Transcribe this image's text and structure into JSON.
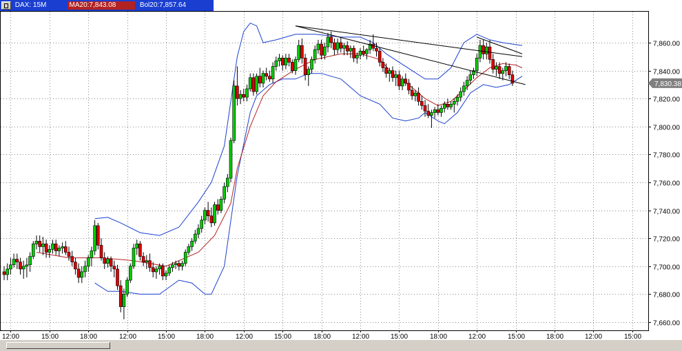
{
  "header": {
    "symbol_label": "DAX: 15M",
    "ma_label": "MA20:7,843.08",
    "bol_label": "Bol20:7,857.64"
  },
  "price_tag": "7,830.38",
  "colors": {
    "up_candle": "#00cc00",
    "down_candle": "#dd0000",
    "ma_line": "#b22222",
    "bollinger": "#1a3fd0",
    "header_bg": "#1a3fd0"
  },
  "chart_data": {
    "type": "candlestick",
    "ylim": [
      7655,
      7880
    ],
    "y_ticks": [
      7660,
      7680,
      7700,
      7720,
      7740,
      7760,
      7780,
      7800,
      7820,
      7840,
      7860
    ],
    "y_tick_labels": [
      "7,660.00",
      "7,680.00",
      "7,700.00",
      "7,720.00",
      "7,740.00",
      "7,760.00",
      "7,780.00",
      "7,800.00",
      "7,820.00",
      "7,840.00",
      "7,860.00"
    ],
    "x_ticks": [
      {
        "label": "12:00",
        "i": 2
      },
      {
        "label": "15:00",
        "i": 14
      },
      {
        "label": "18:00",
        "i": 26
      },
      {
        "label": "12:00",
        "i": 38
      },
      {
        "label": "15:00",
        "i": 50
      },
      {
        "label": "18:00",
        "i": 62
      },
      {
        "label": "12:00",
        "i": 74
      },
      {
        "label": "15:00",
        "i": 86
      },
      {
        "label": "18:00",
        "i": 98
      },
      {
        "label": "12:00",
        "i": 110
      },
      {
        "label": "15:00",
        "i": 122
      },
      {
        "label": "18:00",
        "i": 134
      },
      {
        "label": "12:00",
        "i": 146
      },
      {
        "label": "15:00",
        "i": 158
      },
      {
        "label": "18:00",
        "i": 170
      },
      {
        "label": "12:00",
        "i": 182
      },
      {
        "label": "15:00",
        "i": 194
      }
    ],
    "candles": [
      [
        7696,
        7700,
        7690,
        7694
      ],
      [
        7694,
        7702,
        7690,
        7698
      ],
      [
        7698,
        7706,
        7694,
        7701
      ],
      [
        7701,
        7709,
        7699,
        7705
      ],
      [
        7705,
        7709,
        7698,
        7703
      ],
      [
        7703,
        7706,
        7694,
        7698
      ],
      [
        7698,
        7704,
        7691,
        7700
      ],
      [
        7700,
        7706,
        7692,
        7701
      ],
      [
        7701,
        7710,
        7696,
        7707
      ],
      [
        7707,
        7718,
        7705,
        7716
      ],
      [
        7716,
        7722,
        7712,
        7718
      ],
      [
        7718,
        7722,
        7710,
        7714
      ],
      [
        7714,
        7721,
        7708,
        7716
      ],
      [
        7716,
        7719,
        7706,
        7710
      ],
      [
        7710,
        7715,
        7706,
        7712
      ],
      [
        7712,
        7719,
        7709,
        7716
      ],
      [
        7716,
        7719,
        7708,
        7711
      ],
      [
        7711,
        7715,
        7707,
        7713
      ],
      [
        7713,
        7717,
        7709,
        7714
      ],
      [
        7714,
        7718,
        7708,
        7710
      ],
      [
        7710,
        7714,
        7704,
        7707
      ],
      [
        7707,
        7711,
        7700,
        7703
      ],
      [
        7703,
        7706,
        7694,
        7698
      ],
      [
        7698,
        7702,
        7688,
        7692
      ],
      [
        7692,
        7700,
        7688,
        7696
      ],
      [
        7696,
        7704,
        7692,
        7700
      ],
      [
        7700,
        7708,
        7696,
        7706
      ],
      [
        7706,
        7714,
        7700,
        7711
      ],
      [
        7711,
        7733,
        7708,
        7729
      ],
      [
        7729,
        7731,
        7712,
        7715
      ],
      [
        7715,
        7720,
        7704,
        7706
      ],
      [
        7706,
        7710,
        7698,
        7702
      ],
      [
        7702,
        7707,
        7699,
        7705
      ],
      [
        7705,
        7707,
        7696,
        7700
      ],
      [
        7700,
        7704,
        7692,
        7698
      ],
      [
        7698,
        7701,
        7683,
        7686
      ],
      [
        7686,
        7690,
        7667,
        7671
      ],
      [
        7671,
        7684,
        7662,
        7680
      ],
      [
        7680,
        7692,
        7678,
        7690
      ],
      [
        7690,
        7702,
        7688,
        7700
      ],
      [
        7700,
        7716,
        7698,
        7713
      ],
      [
        7713,
        7719,
        7708,
        7716
      ],
      [
        7716,
        7718,
        7704,
        7707
      ],
      [
        7707,
        7710,
        7700,
        7703
      ],
      [
        7703,
        7708,
        7698,
        7704
      ],
      [
        7704,
        7709,
        7696,
        7699
      ],
      [
        7699,
        7703,
        7692,
        7696
      ],
      [
        7696,
        7700,
        7691,
        7698
      ],
      [
        7698,
        7702,
        7694,
        7700
      ],
      [
        7700,
        7702,
        7690,
        7693
      ],
      [
        7693,
        7697,
        7690,
        7695
      ],
      [
        7695,
        7701,
        7693,
        7699
      ],
      [
        7699,
        7703,
        7696,
        7701
      ],
      [
        7701,
        7704,
        7698,
        7702
      ],
      [
        7702,
        7704,
        7697,
        7700
      ],
      [
        7700,
        7704,
        7697,
        7702
      ],
      [
        7702,
        7712,
        7700,
        7710
      ],
      [
        7710,
        7716,
        7708,
        7714
      ],
      [
        7714,
        7720,
        7711,
        7718
      ],
      [
        7718,
        7726,
        7716,
        7723
      ],
      [
        7723,
        7730,
        7720,
        7727
      ],
      [
        7727,
        7736,
        7724,
        7733
      ],
      [
        7733,
        7742,
        7730,
        7740
      ],
      [
        7740,
        7746,
        7732,
        7736
      ],
      [
        7736,
        7742,
        7728,
        7731
      ],
      [
        7731,
        7746,
        7729,
        7744
      ],
      [
        7744,
        7748,
        7737,
        7740
      ],
      [
        7740,
        7750,
        7738,
        7748
      ],
      [
        7748,
        7760,
        7745,
        7757
      ],
      [
        7757,
        7766,
        7753,
        7763
      ],
      [
        7763,
        7792,
        7760,
        7790
      ],
      [
        7790,
        7833,
        7788,
        7829
      ],
      [
        7829,
        7843,
        7815,
        7820
      ],
      [
        7820,
        7826,
        7816,
        7823
      ],
      [
        7823,
        7827,
        7818,
        7821
      ],
      [
        7821,
        7830,
        7818,
        7827
      ],
      [
        7827,
        7838,
        7825,
        7835
      ],
      [
        7835,
        7838,
        7822,
        7825
      ],
      [
        7825,
        7838,
        7823,
        7836
      ],
      [
        7836,
        7842,
        7828,
        7831
      ],
      [
        7831,
        7840,
        7828,
        7838
      ],
      [
        7838,
        7842,
        7833,
        7836
      ],
      [
        7836,
        7840,
        7832,
        7834
      ],
      [
        7834,
        7846,
        7831,
        7843
      ],
      [
        7843,
        7850,
        7840,
        7847
      ],
      [
        7847,
        7852,
        7843,
        7849
      ],
      [
        7849,
        7851,
        7840,
        7844
      ],
      [
        7844,
        7852,
        7841,
        7849
      ],
      [
        7849,
        7852,
        7843,
        7846
      ],
      [
        7846,
        7848,
        7838,
        7840
      ],
      [
        7840,
        7850,
        7837,
        7848
      ],
      [
        7848,
        7862,
        7846,
        7858
      ],
      [
        7858,
        7863,
        7845,
        7849
      ],
      [
        7849,
        7852,
        7833,
        7837
      ],
      [
        7837,
        7843,
        7829,
        7841
      ],
      [
        7841,
        7850,
        7838,
        7848
      ],
      [
        7848,
        7858,
        7845,
        7855
      ],
      [
        7855,
        7862,
        7852,
        7859
      ],
      [
        7859,
        7862,
        7848,
        7851
      ],
      [
        7851,
        7860,
        7848,
        7857
      ],
      [
        7857,
        7867,
        7853,
        7864
      ],
      [
        7864,
        7868,
        7856,
        7860
      ],
      [
        7860,
        7863,
        7851,
        7855
      ],
      [
        7855,
        7863,
        7852,
        7860
      ],
      [
        7860,
        7864,
        7853,
        7856
      ],
      [
        7856,
        7860,
        7851,
        7858
      ],
      [
        7858,
        7861,
        7851,
        7854
      ],
      [
        7854,
        7858,
        7849,
        7856
      ],
      [
        7856,
        7858,
        7846,
        7849
      ],
      [
        7849,
        7853,
        7845,
        7851
      ],
      [
        7851,
        7856,
        7848,
        7854
      ],
      [
        7854,
        7858,
        7850,
        7852
      ],
      [
        7852,
        7856,
        7848,
        7855
      ],
      [
        7855,
        7862,
        7852,
        7859
      ],
      [
        7859,
        7866,
        7854,
        7856
      ],
      [
        7856,
        7860,
        7850,
        7854
      ],
      [
        7854,
        7856,
        7843,
        7846
      ],
      [
        7846,
        7849,
        7839,
        7842
      ],
      [
        7842,
        7845,
        7835,
        7838
      ],
      [
        7838,
        7842,
        7832,
        7840
      ],
      [
        7840,
        7843,
        7832,
        7835
      ],
      [
        7835,
        7840,
        7829,
        7837
      ],
      [
        7837,
        7840,
        7826,
        7829
      ],
      [
        7829,
        7836,
        7826,
        7834
      ],
      [
        7834,
        7838,
        7829,
        7831
      ],
      [
        7831,
        7834,
        7823,
        7826
      ],
      [
        7826,
        7829,
        7819,
        7822
      ],
      [
        7822,
        7826,
        7818,
        7824
      ],
      [
        7824,
        7828,
        7815,
        7818
      ],
      [
        7818,
        7822,
        7812,
        7815
      ],
      [
        7815,
        7819,
        7807,
        7811
      ],
      [
        7811,
        7816,
        7806,
        7808
      ],
      [
        7808,
        7812,
        7799,
        7810
      ],
      [
        7810,
        7814,
        7806,
        7812
      ],
      [
        7812,
        7816,
        7808,
        7810
      ],
      [
        7810,
        7815,
        7807,
        7813
      ],
      [
        7813,
        7818,
        7810,
        7816
      ],
      [
        7816,
        7820,
        7812,
        7814
      ],
      [
        7814,
        7818,
        7812,
        7816
      ],
      [
        7816,
        7820,
        7810,
        7818
      ],
      [
        7818,
        7823,
        7815,
        7821
      ],
      [
        7821,
        7828,
        7818,
        7825
      ],
      [
        7825,
        7832,
        7822,
        7829
      ],
      [
        7829,
        7836,
        7826,
        7833
      ],
      [
        7833,
        7840,
        7830,
        7837
      ],
      [
        7837,
        7842,
        7834,
        7840
      ],
      [
        7840,
        7852,
        7836,
        7849
      ],
      [
        7849,
        7862,
        7846,
        7858
      ],
      [
        7858,
        7862,
        7848,
        7852
      ],
      [
        7852,
        7860,
        7848,
        7857
      ],
      [
        7857,
        7862,
        7845,
        7848
      ],
      [
        7848,
        7852,
        7838,
        7841
      ],
      [
        7841,
        7846,
        7836,
        7843
      ],
      [
        7843,
        7846,
        7834,
        7838
      ],
      [
        7838,
        7842,
        7833,
        7840
      ],
      [
        7840,
        7846,
        7836,
        7843
      ],
      [
        7843,
        7845,
        7834,
        7837
      ],
      [
        7837,
        7840,
        7829,
        7831
      ]
    ],
    "ma20": [
      [
        10,
        7710
      ],
      [
        20,
        7706
      ],
      [
        30,
        7706
      ],
      [
        40,
        7704
      ],
      [
        50,
        7700
      ],
      [
        60,
        7710
      ],
      [
        65,
        7722
      ],
      [
        70,
        7745
      ],
      [
        72,
        7770
      ],
      [
        76,
        7800
      ],
      [
        80,
        7822
      ],
      [
        84,
        7832
      ],
      [
        90,
        7841
      ],
      [
        96,
        7848
      ],
      [
        104,
        7852
      ],
      [
        110,
        7852
      ],
      [
        116,
        7848
      ],
      [
        120,
        7838
      ],
      [
        126,
        7828
      ],
      [
        130,
        7820
      ],
      [
        134,
        7815
      ],
      [
        138,
        7818
      ],
      [
        142,
        7826
      ],
      [
        146,
        7835
      ],
      [
        150,
        7842
      ],
      [
        154,
        7845
      ],
      [
        158,
        7844
      ],
      [
        160,
        7842
      ]
    ],
    "bollinger_upper": [
      [
        28,
        7734
      ],
      [
        32,
        7735
      ],
      [
        36,
        7731
      ],
      [
        42,
        7724
      ],
      [
        48,
        7722
      ],
      [
        54,
        7728
      ],
      [
        60,
        7746
      ],
      [
        64,
        7760
      ],
      [
        68,
        7786
      ],
      [
        72,
        7850
      ],
      [
        74,
        7868
      ],
      [
        76,
        7874
      ],
      [
        78,
        7872
      ],
      [
        80,
        7860
      ],
      [
        84,
        7862
      ],
      [
        90,
        7866
      ],
      [
        96,
        7866
      ],
      [
        104,
        7864
      ],
      [
        110,
        7864
      ],
      [
        114,
        7860
      ],
      [
        118,
        7852
      ],
      [
        122,
        7846
      ],
      [
        126,
        7840
      ],
      [
        130,
        7834
      ],
      [
        134,
        7834
      ],
      [
        138,
        7842
      ],
      [
        142,
        7860
      ],
      [
        146,
        7866
      ],
      [
        150,
        7862
      ],
      [
        154,
        7860
      ],
      [
        160,
        7858
      ]
    ],
    "bollinger_lower": [
      [
        28,
        7688
      ],
      [
        32,
        7682
      ],
      [
        36,
        7682
      ],
      [
        42,
        7680
      ],
      [
        48,
        7680
      ],
      [
        54,
        7690
      ],
      [
        58,
        7688
      ],
      [
        62,
        7680
      ],
      [
        64,
        7680
      ],
      [
        68,
        7700
      ],
      [
        72,
        7765
      ],
      [
        76,
        7810
      ],
      [
        78,
        7822
      ],
      [
        82,
        7830
      ],
      [
        86,
        7834
      ],
      [
        90,
        7834
      ],
      [
        94,
        7838
      ],
      [
        98,
        7838
      ],
      [
        104,
        7834
      ],
      [
        110,
        7822
      ],
      [
        116,
        7816
      ],
      [
        120,
        7806
      ],
      [
        124,
        7804
      ],
      [
        128,
        7806
      ],
      [
        130,
        7810
      ],
      [
        134,
        7804
      ],
      [
        136,
        7802
      ],
      [
        140,
        7810
      ],
      [
        144,
        7824
      ],
      [
        148,
        7830
      ],
      [
        152,
        7828
      ],
      [
        156,
        7830
      ],
      [
        160,
        7836
      ]
    ],
    "trendlines": [
      {
        "from": [
          90,
          7872
        ],
        "to": [
          160,
          7850
        ]
      },
      {
        "from": [
          90,
          7872
        ],
        "to": [
          161,
          7830
        ]
      },
      {
        "from": [
          146,
          7864
        ],
        "to": [
          160,
          7852
        ]
      }
    ]
  }
}
